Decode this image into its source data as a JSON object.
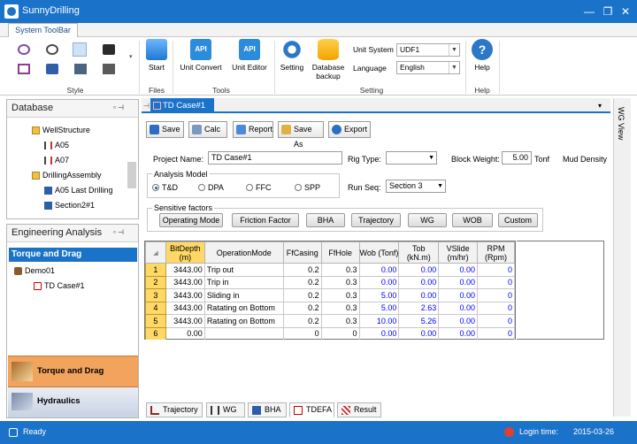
{
  "app": {
    "title": "SunnyDrilling"
  },
  "window_controls": {
    "minimize": "—",
    "restore": "❐",
    "close": "✕"
  },
  "ribbon": {
    "tab": "System ToolBar",
    "groups": {
      "style": "Style",
      "files": "Files",
      "tools": "Tools",
      "setting": "Setting",
      "help": "Help"
    },
    "buttons": {
      "start": "Start",
      "unit_convert": "Unit Convert",
      "unit_editor": "Unit Editor",
      "setting": "Setting",
      "database_backup_1": "Database",
      "database_backup_2": "backup",
      "help": "Help"
    },
    "api_icon_text": "API",
    "unit_system_label": "Unit System",
    "unit_system_value": "UDF1",
    "language_label": "Language",
    "language_value": "English"
  },
  "database": {
    "title": "Database",
    "tree": [
      {
        "label": "WellStructure"
      },
      {
        "label": "A05"
      },
      {
        "label": "A07"
      },
      {
        "label": "DrillingAssembly"
      },
      {
        "label": "A05 Last Drilling"
      },
      {
        "label": "Section2#1"
      }
    ]
  },
  "engineering": {
    "title": "Engineering Analysis",
    "section": "Torque and Drag",
    "tree": [
      {
        "label": "Demo01"
      },
      {
        "label": "TD Case#1"
      }
    ],
    "modules": [
      {
        "label": "Torque and Drag"
      },
      {
        "label": "Hydraulics"
      }
    ]
  },
  "doc_tab": {
    "label": "TD Case#1",
    "side_label": "WG View"
  },
  "toolbar": {
    "save": "Save",
    "calc": "Calc",
    "report": "Report",
    "save_as": "Save As",
    "export": "Export"
  },
  "form": {
    "project_name_label": "Project Name:",
    "project_name_value": "TD Case#1",
    "rig_type_label": "Rig Type:",
    "rig_type_value": "",
    "block_weight_label": "Block Weight:",
    "block_weight_value": "5.00",
    "block_weight_unit": "Tonf",
    "mud_density_label": "Mud Density",
    "analysis_model_label": "Analysis Model",
    "models": [
      "T&D",
      "DPA",
      "FFC",
      "SPP"
    ],
    "selected_model": "T&D",
    "run_seq_label": "Run Seq:",
    "run_seq_value": "Section 3",
    "sensitive_factors_label": "Sensitive factors",
    "sensitive_factors": [
      "Operating Mode",
      "Friction Factor",
      "BHA",
      "Trajectory",
      "WG",
      "WOB",
      "Custom"
    ]
  },
  "table": {
    "headers": [
      "BitDepth (m)",
      "OperationMode",
      "FfCasing",
      "FfHole",
      "Wob (Tonf)",
      "Tob (kN.m)",
      "VSlide (m/hr)",
      "RPM (Rpm)"
    ],
    "rows": [
      [
        "1",
        "3443.00",
        "Trip out",
        "0.2",
        "0.3",
        "0.00",
        "0.00",
        "0.00",
        "0"
      ],
      [
        "2",
        "3443.00",
        "Trip in",
        "0.2",
        "0.3",
        "0.00",
        "0.00",
        "0.00",
        "0"
      ],
      [
        "3",
        "3443.00",
        "Sliding in",
        "0.2",
        "0.3",
        "5.00",
        "0.00",
        "0.00",
        "0"
      ],
      [
        "4",
        "3443.00",
        "Ratating on Bottom",
        "0.2",
        "0.3",
        "5.00",
        "2.63",
        "0.00",
        "0"
      ],
      [
        "5",
        "3443.00",
        "Ratating on Bottom",
        "0.2",
        "0.3",
        "10.00",
        "5.26",
        "0.00",
        "0"
      ],
      [
        "6",
        "0.00",
        "",
        "0",
        "0",
        "0.00",
        "0.00",
        "0.00",
        "0"
      ]
    ]
  },
  "bottom_tabs": [
    "Trajectory",
    "WG",
    "BHA",
    "TDEFA",
    "Result"
  ],
  "status": {
    "ready": "Ready",
    "login_label": "Login time:",
    "login_date": "2015-03-26"
  },
  "colors": {
    "accent": "#1b73c9",
    "highlight": "#ffd866",
    "module_active": "#f2a35e"
  }
}
